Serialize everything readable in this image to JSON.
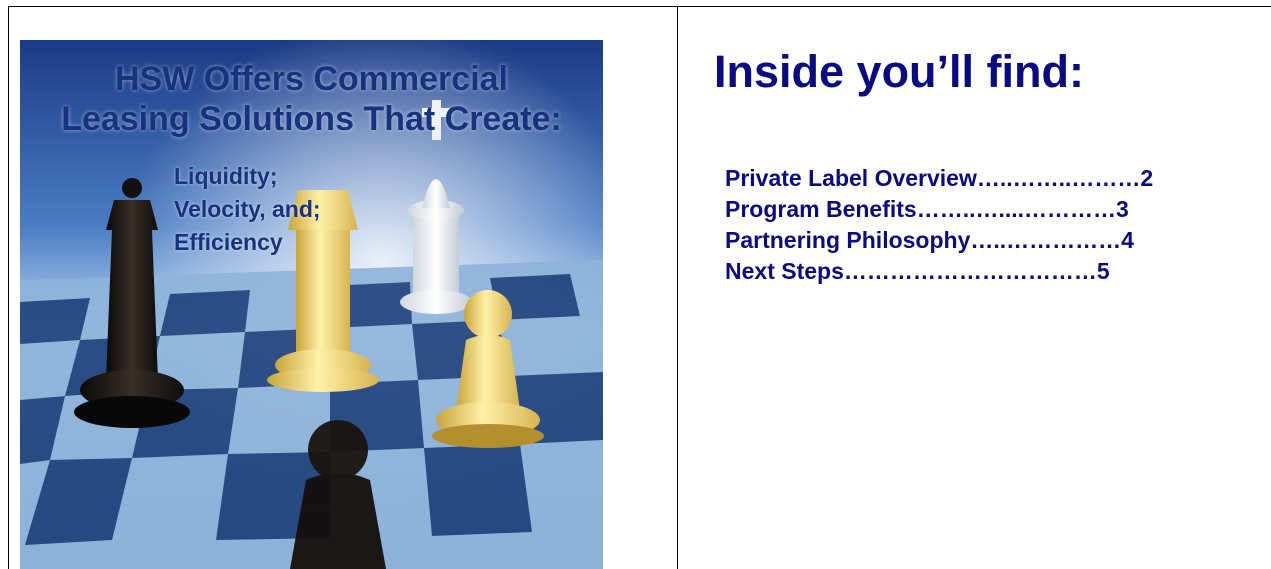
{
  "cover": {
    "headline_line1": "HSW Offers Commercial",
    "headline_line2": "Leasing Solutions That Create:",
    "benefits": [
      "Liquidity;",
      "Velocity, and;",
      "Efficiency"
    ]
  },
  "contents": {
    "heading": "Inside you’ll find:",
    "entries": [
      {
        "text": "Private Label Overview…..……..………2"
      },
      {
        "text": "Program Benefits……..…....…………3"
      },
      {
        "text": "Partnering Philosophy…..……………4"
      },
      {
        "text": "Next Steps……………………………5"
      }
    ]
  },
  "colors": {
    "heading_blue": "#0a0a82",
    "cover_text_blue": "#17337f"
  }
}
